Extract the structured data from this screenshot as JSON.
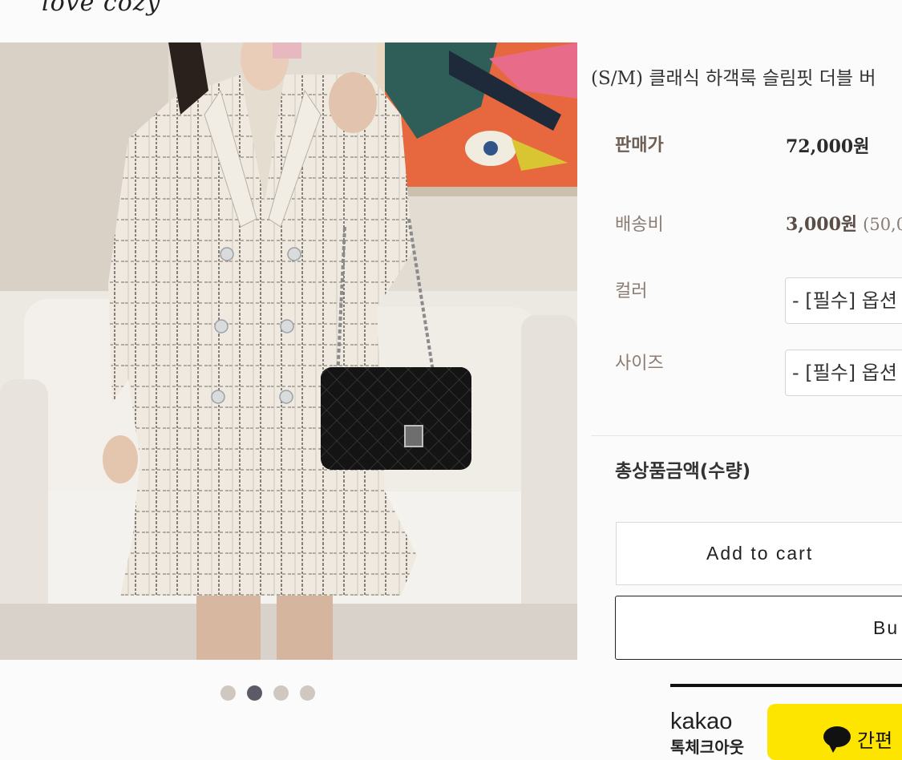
{
  "brand": {
    "logo_text": "love cozy"
  },
  "gallery": {
    "dot_count": 4,
    "active_index": 1
  },
  "product": {
    "size_tag": "(S/M)",
    "title": "클래식 하객룩 슬림핏 더블 버"
  },
  "info": {
    "price_label": "판매가",
    "price_value": "72,000원",
    "shipping_label": "배송비",
    "shipping_value": "3,000원",
    "shipping_note": "(50,0",
    "color_label": "컬러",
    "color_select": "- [필수] 옵션",
    "size_label": "사이즈",
    "size_select": "- [필수] 옵션"
  },
  "total": {
    "label": "총상품금액(수량)"
  },
  "actions": {
    "add_to_cart": "Add to cart",
    "buy": "Bu"
  },
  "kakao": {
    "logo": "kakao",
    "sub": "톡체크아웃",
    "button_label": "간편"
  }
}
